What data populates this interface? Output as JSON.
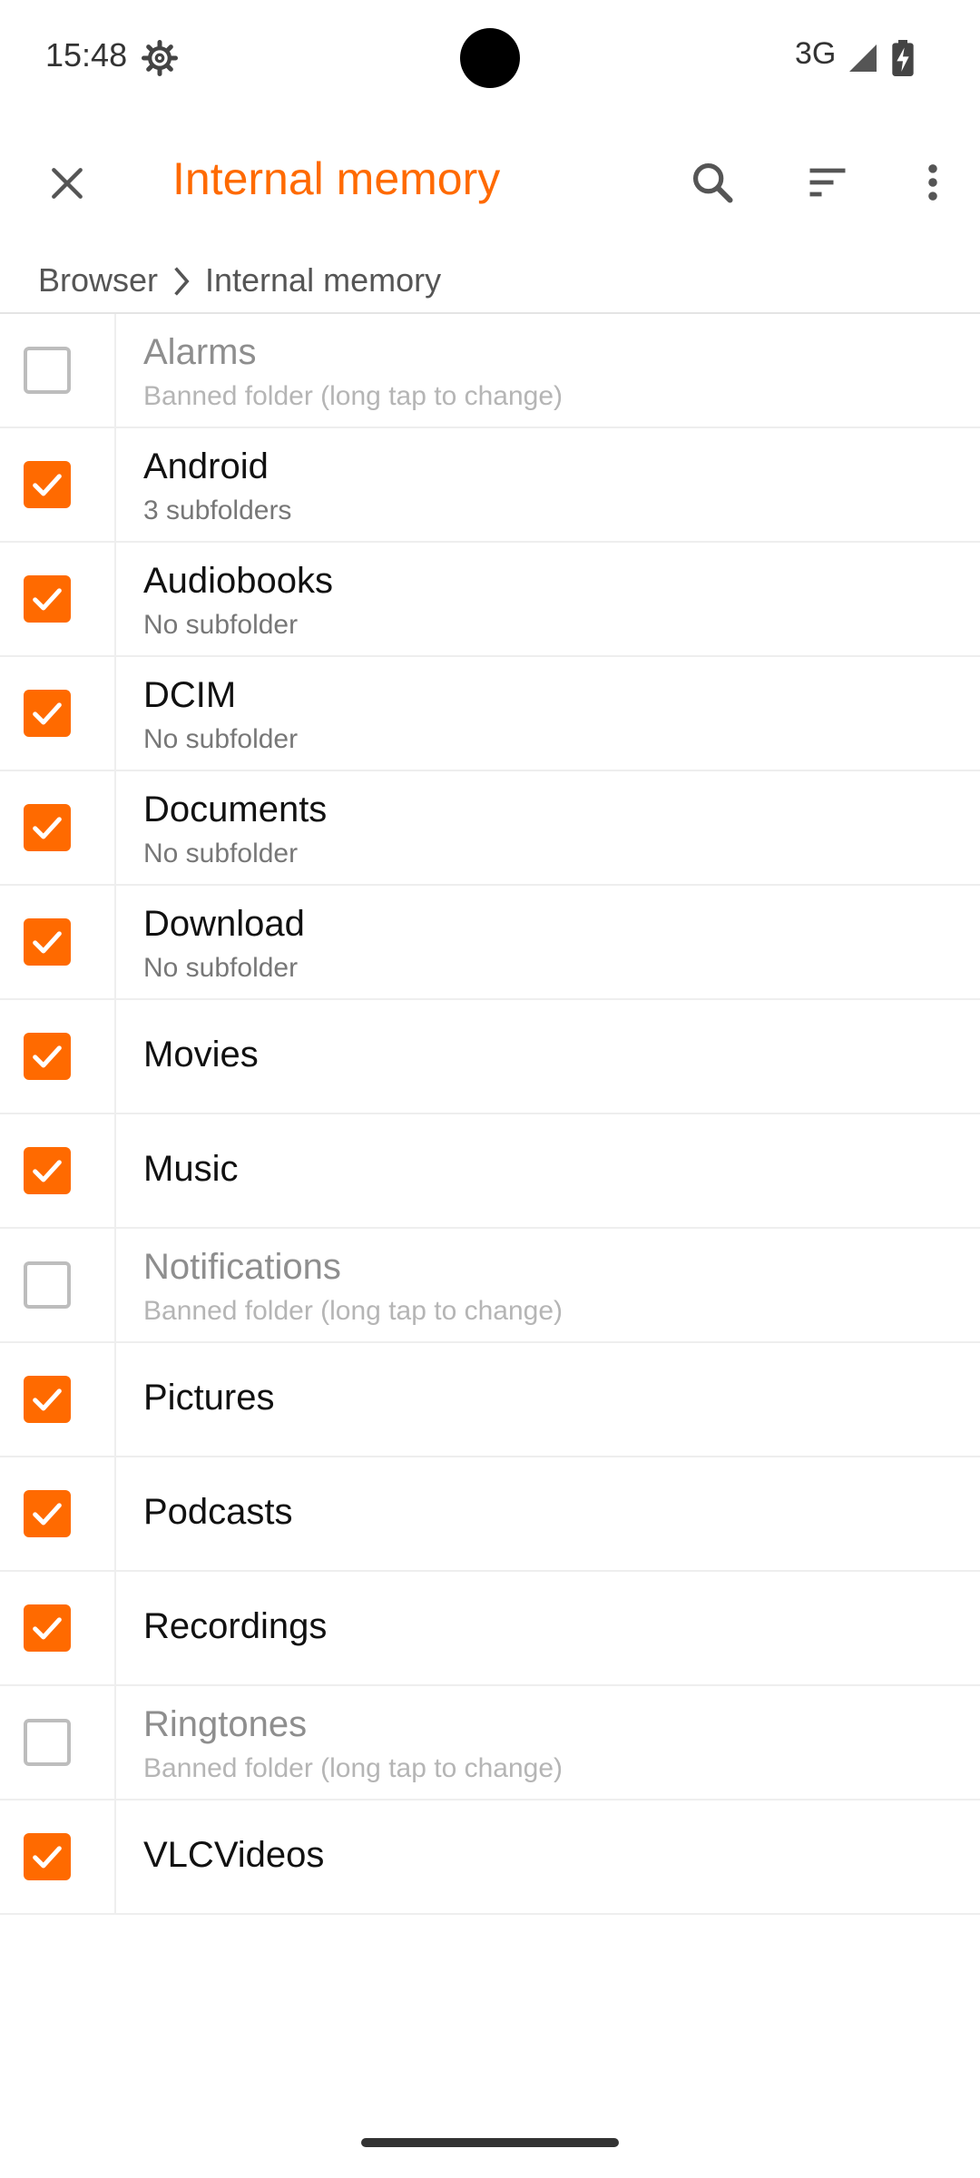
{
  "status_bar": {
    "time": "15:48",
    "network": "3G",
    "icons": [
      "gear-icon",
      "signal-icon",
      "battery-icon"
    ]
  },
  "toolbar": {
    "title": "Internal memory",
    "close_icon": "close-icon",
    "actions": [
      "search-icon",
      "sort-icon",
      "more-vert-icon"
    ],
    "accent_color": "#ff6a00"
  },
  "breadcrumb": {
    "root": "Browser",
    "current": "Internal memory"
  },
  "folders": [
    {
      "name": "Alarms",
      "subtitle": "Banned folder (long tap to change)",
      "checked": false
    },
    {
      "name": "Android",
      "subtitle": "3 subfolders",
      "checked": true
    },
    {
      "name": "Audiobooks",
      "subtitle": "No subfolder",
      "checked": true
    },
    {
      "name": "DCIM",
      "subtitle": "No subfolder",
      "checked": true
    },
    {
      "name": "Documents",
      "subtitle": "No subfolder",
      "checked": true
    },
    {
      "name": "Download",
      "subtitle": "No subfolder",
      "checked": true
    },
    {
      "name": "Movies",
      "subtitle": "",
      "checked": true
    },
    {
      "name": "Music",
      "subtitle": "",
      "checked": true
    },
    {
      "name": "Notifications",
      "subtitle": "Banned folder (long tap to change)",
      "checked": false
    },
    {
      "name": "Pictures",
      "subtitle": "",
      "checked": true
    },
    {
      "name": "Podcasts",
      "subtitle": "",
      "checked": true
    },
    {
      "name": "Recordings",
      "subtitle": "",
      "checked": true
    },
    {
      "name": "Ringtones",
      "subtitle": "Banned folder (long tap to change)",
      "checked": false
    },
    {
      "name": "VLCVideos",
      "subtitle": "",
      "checked": true
    }
  ]
}
